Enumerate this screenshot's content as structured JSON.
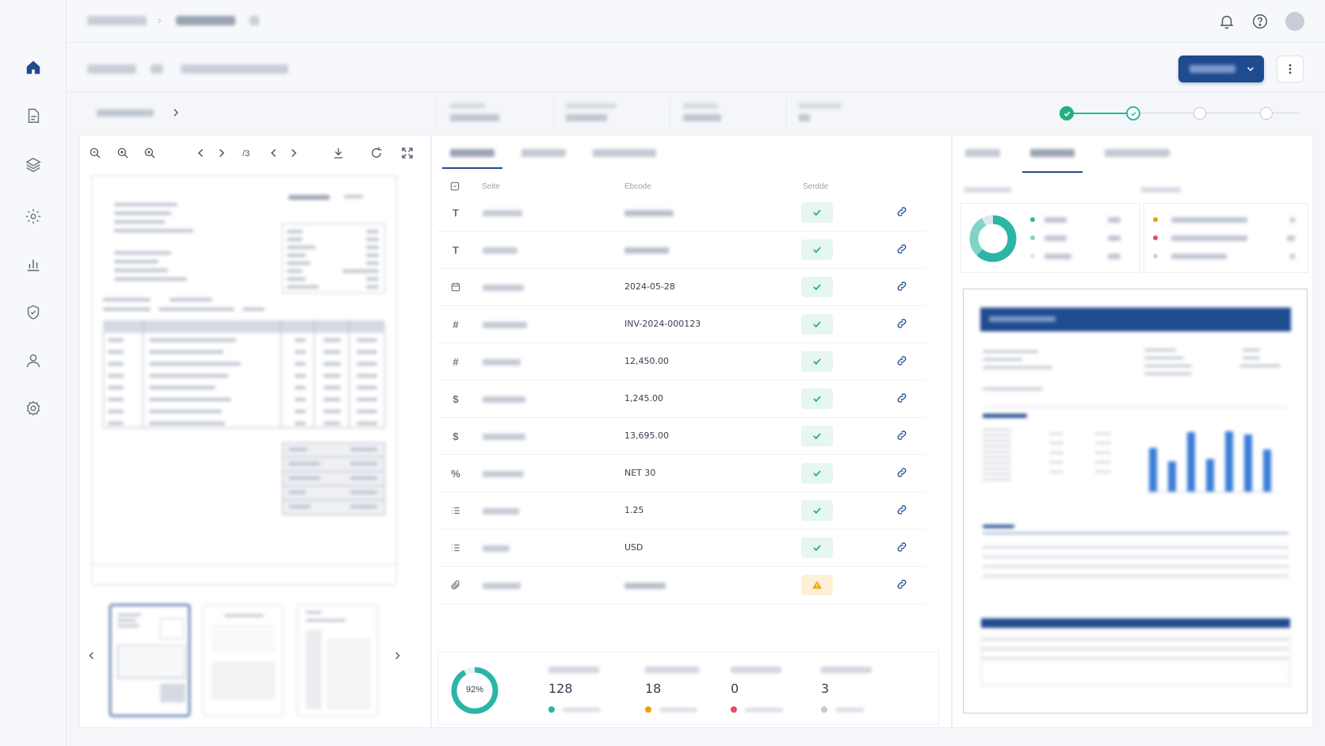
{
  "toolbar": {
    "page_indicator": "/3"
  },
  "fields": {
    "headers": [
      "Seite",
      "Ebcode",
      "Serdde"
    ],
    "rows": [
      {
        "icon": "T",
        "value": "",
        "status": "ok"
      },
      {
        "icon": "T",
        "value": "",
        "status": "ok"
      },
      {
        "icon": "calendar",
        "value": "2024-05-28",
        "status": "ok"
      },
      {
        "icon": "#",
        "value": "INV-2024-000123",
        "status": "ok"
      },
      {
        "icon": "#",
        "value": "12,450.00",
        "status": "ok"
      },
      {
        "icon": "$",
        "value": "1,245.00",
        "status": "ok"
      },
      {
        "icon": "$",
        "value": "13,695.00",
        "status": "ok"
      },
      {
        "icon": "%",
        "value": "NET 30",
        "status": "ok"
      },
      {
        "icon": "list",
        "value": "1.25",
        "status": "ok"
      },
      {
        "icon": "list",
        "value": "USD",
        "status": "ok"
      },
      {
        "icon": "paperclip",
        "value": "",
        "status": "warn"
      }
    ]
  },
  "summary": {
    "confidence_label": "92%",
    "confidence_value": 92,
    "counts": [
      "128",
      "18",
      "0",
      "3"
    ]
  },
  "colors": {
    "primary": "#1f4b8f",
    "teal": "#2bb5a5",
    "success": "#22b07d",
    "warning": "#f2a40c",
    "danger": "#e04f5f",
    "orange": "#f59e0b",
    "chart_blue": "#3b7dd8"
  }
}
